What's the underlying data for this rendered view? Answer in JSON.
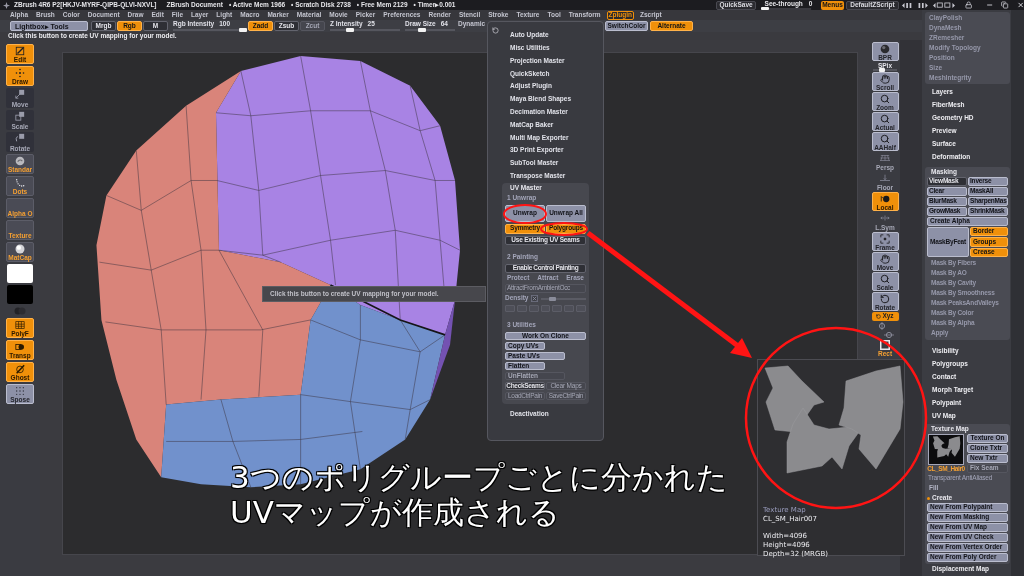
{
  "title_bar": {
    "app_title": "ZBrush 4R6 P2[HKJV-MYRF-QIPB-QLVI-NXVL]",
    "document": "ZBrush Document",
    "stats": [
      "• Active Mem 1966",
      "• Scratch Disk 2738",
      "• Free Mem 2129",
      "• Timer▸0.001"
    ],
    "quicksave": "QuickSave",
    "see_through": {
      "label": "See-through",
      "reading": "0",
      "level": 0
    },
    "menus": {
      "label": "Menus",
      "on": true
    },
    "script": "DefaultZScript"
  },
  "menu_bar": [
    {
      "label": "Alpha",
      "selected": false
    },
    {
      "label": "Brush",
      "selected": false
    },
    {
      "label": "Color",
      "selected": false
    },
    {
      "label": "Document",
      "selected": false
    },
    {
      "label": "Draw",
      "selected": false
    },
    {
      "label": "Edit",
      "selected": false
    },
    {
      "label": "File",
      "selected": false
    },
    {
      "label": "Layer",
      "selected": false
    },
    {
      "label": "Light",
      "selected": false
    },
    {
      "label": "Macro",
      "selected": false
    },
    {
      "label": "Marker",
      "selected": false
    },
    {
      "label": "Material",
      "selected": false
    },
    {
      "label": "Movie",
      "selected": false
    },
    {
      "label": "Picker",
      "selected": false
    },
    {
      "label": "Preferences",
      "selected": false
    },
    {
      "label": "Render",
      "selected": false
    },
    {
      "label": "Stencil",
      "selected": false
    },
    {
      "label": "Stroke",
      "selected": false
    },
    {
      "label": "Texture",
      "selected": false
    },
    {
      "label": "Tool",
      "selected": false
    },
    {
      "label": "Transform",
      "selected": false
    },
    {
      "label": "Zplugin",
      "selected": true
    },
    {
      "label": "Zscript",
      "selected": false
    }
  ],
  "shelf": [
    {
      "kind": "lightbox",
      "label": "Lightbox▸ Tools",
      "on": false,
      "disabled": false
    },
    {
      "kind": "button",
      "label": "Mrgb",
      "on": false,
      "disabled": false
    },
    {
      "kind": "button",
      "label": "Rgb",
      "on": true,
      "disabled": false
    },
    {
      "kind": "button",
      "label": "M",
      "on": false,
      "disabled": false
    },
    {
      "kind": "slider",
      "label": "Rgb Intensity",
      "reading": "100",
      "level": 1
    },
    {
      "kind": "button",
      "label": "Zadd",
      "on": true,
      "disabled": false
    },
    {
      "kind": "button",
      "label": "Zsub",
      "on": false,
      "disabled": false
    },
    {
      "kind": "button",
      "label": "Zcut",
      "on": false,
      "disabled": true
    },
    {
      "kind": "slider",
      "label": "Z Intensity",
      "reading": "25",
      "level": 0.25
    },
    {
      "kind": "slider",
      "label": "Draw Size",
      "reading": "64",
      "level": 0.3
    },
    {
      "kind": "text",
      "label": "Dynamic"
    }
  ],
  "shelf_right": [
    {
      "label": "SwitchColor",
      "on": false
    },
    {
      "label": "Alternate",
      "on": true
    }
  ],
  "help_line": "Click this button to create UV mapping for your model.",
  "left_toolbar": {
    "modes": [
      {
        "kind": "edit",
        "label": "Edit",
        "on": true
      },
      {
        "kind": "draw",
        "label": "Draw",
        "on": true
      },
      {
        "kind": "move",
        "label": "Move",
        "on": false
      },
      {
        "kind": "scale",
        "label": "Scale",
        "on": false
      },
      {
        "kind": "rotate",
        "label": "Rotate",
        "on": false
      }
    ],
    "previews": [
      {
        "kind": "brush",
        "label": "Standar"
      },
      {
        "kind": "stroke",
        "label": "Dots"
      },
      {
        "kind": "alpha",
        "label": "Alpha O"
      },
      {
        "kind": "texture",
        "label": "Texture"
      },
      {
        "kind": "material",
        "label": "MatCap"
      }
    ],
    "swatches": [
      {
        "color": "#ffffff"
      },
      {
        "color": "#000000"
      }
    ],
    "toggles": [
      {
        "kind": "polyframe",
        "label": "PolyF",
        "on": true
      },
      {
        "kind": "transparency",
        "label": "Transp",
        "on": true
      },
      {
        "kind": "ghost",
        "label": "Ghost",
        "on": true
      },
      {
        "kind": "spose",
        "label": "Spose",
        "on": false
      }
    ]
  },
  "right_shelf": {
    "bpr": {
      "label": "BPR"
    },
    "spix": {
      "label": "SPix",
      "level": 0.35
    },
    "buttons": [
      {
        "kind": "scroll",
        "label": "Scroll",
        "on": false
      },
      {
        "kind": "zoom",
        "label": "Zoom",
        "on": false
      },
      {
        "kind": "actual",
        "label": "Actual",
        "on": false
      },
      {
        "kind": "aahalf",
        "label": "AAHalf",
        "on": false
      },
      {
        "kind": "persp",
        "label": "Persp",
        "on": false
      },
      {
        "kind": "floor",
        "label": "Floor",
        "on": false
      },
      {
        "kind": "local",
        "label": "Local",
        "on": true
      },
      {
        "kind": "lsym",
        "label": "L.Sym",
        "on": false
      },
      {
        "kind": "frame",
        "label": "Frame",
        "on": false
      },
      {
        "kind": "move",
        "label": "Move",
        "on": false
      },
      {
        "kind": "scale",
        "label": "Scale",
        "on": false
      },
      {
        "kind": "rotate",
        "label": "Rotate",
        "on": false
      },
      {
        "kind": "xyz",
        "label": "Xyz",
        "on": true
      }
    ],
    "square": {
      "label": "Rect"
    }
  },
  "tooltip": "Click this button to create UV mapping for your model.",
  "zplugin_menu": {
    "items": [
      "Auto Update",
      "Misc Utilities",
      "Projection Master",
      "QuickSketch",
      "Adjust Plugin",
      "Maya Blend Shapes",
      "Decimation Master",
      "MatCap Baker",
      "Multi Map Exporter",
      "3D Print Exporter",
      "SubTool Master",
      "Transpose Master"
    ],
    "uv_master": {
      "title": "UV Master",
      "unwrap": {
        "heading": "1 Unwrap",
        "buttons": [
          {
            "label": "Unwrap",
            "disabled": false
          },
          {
            "label": "Unwrap All",
            "disabled": false
          }
        ],
        "switches": [
          {
            "label": "Symmetry",
            "on": true
          },
          {
            "label": "Polygroups",
            "on": true
          }
        ],
        "seams": {
          "label": "Use Existing UV Seams",
          "on": false
        }
      },
      "painting": {
        "heading": "2 Painting",
        "control": {
          "label": "Enable Control Painting",
          "on": false
        },
        "modes": [
          {
            "label": "Protect",
            "disabled": true
          },
          {
            "label": "Attract",
            "disabled": true
          },
          {
            "label": "Erase",
            "disabled": true
          }
        ],
        "ambient": {
          "label": "AttractFromAmbientOcc",
          "disabled": true
        },
        "density": {
          "label": "Density",
          "disabled": true
        }
      },
      "utilities": {
        "heading": "3 Utilities",
        "buttons": [
          {
            "label": "Work On Clone",
            "disabled": false
          },
          {
            "label": "Copy UVs",
            "disabled": false
          },
          {
            "label": "Paste UVs",
            "disabled": false
          },
          {
            "label": "Flatten",
            "disabled": false
          },
          {
            "label": "UnFlatten",
            "disabled": true
          }
        ],
        "check_seams": {
          "label": "CheckSeams",
          "on": false
        },
        "clear_maps": {
          "label": "Clear Maps",
          "disabled": true
        },
        "control_files": [
          {
            "label": "LoadCtrlPain",
            "disabled": true
          },
          {
            "label": "SaveCtrlPain",
            "disabled": true
          }
        ]
      }
    },
    "deactivation": "Deactivation"
  },
  "texture_preview": {
    "title": "Texture Map",
    "name": "CL_SM_Hair007",
    "info": [
      "Width=4096",
      "Height=4096",
      "Depth=32 (MRGB)"
    ]
  },
  "caption": [
    "3つのポリグループごとに分かれた",
    "UVマップが作成される"
  ],
  "tool_palette": {
    "top_group": [
      "ClayPolish",
      "DynaMesh",
      "ZRemesher",
      "Modify Topology",
      "Position",
      "Size",
      "MeshIntegrity"
    ],
    "sections_1": [
      "Layers",
      "FiberMesh",
      "Geometry HD",
      "Preview",
      "Surface",
      "Deformation"
    ],
    "masking": {
      "title": "Masking",
      "grid": [
        {
          "kind": "switch",
          "label": "ViewMask",
          "on": false
        },
        {
          "kind": "button",
          "label": "Inverse"
        },
        {
          "kind": "button",
          "label": "Clear"
        },
        {
          "kind": "button",
          "label": "MaskAll"
        },
        {
          "kind": "button",
          "label": "BlurMask"
        },
        {
          "kind": "button",
          "label": "SharpenMas"
        },
        {
          "kind": "button",
          "label": "GrowMask"
        },
        {
          "kind": "button",
          "label": "ShrinkMask"
        }
      ],
      "create_alpha": "Create Alpha",
      "mask_by_feature": "MaskByFeat",
      "feature_switches": [
        {
          "label": "Border",
          "on": true
        },
        {
          "label": "Groups",
          "on": true
        },
        {
          "label": "Crease",
          "on": true
        }
      ],
      "sub_items": [
        "Mask By Fibers",
        "Mask By AO",
        "Mask By Cavity",
        "Mask By Smoothness",
        "Mask PeaksAndValleys",
        "Mask By Color",
        "Mask By Alpha",
        "Apply"
      ]
    },
    "sections_2": [
      "Visibility",
      "Polygroups",
      "Contact",
      "Morph Target",
      "Polypaint",
      "UV Map"
    ],
    "texture_map": {
      "title": "Texture Map",
      "thumbnail_label": "CL_SM_Hair0",
      "texture_on": {
        "label": "Texture On",
        "on": false
      },
      "buttons": [
        {
          "label": "Clone Txtr",
          "disabled": false
        },
        {
          "label": "New Txtr",
          "disabled": false
        },
        {
          "label": "Fix Seam",
          "disabled": true
        }
      ],
      "transparent": "Transparent AntiAliased",
      "fill": "Fill",
      "create": "Create",
      "create_buttons": [
        "New From Polypaint",
        "New From Masking",
        "New From UV Map",
        "New From UV Check",
        "New From Vertex Order",
        "New From Poly Order"
      ]
    },
    "sections_3": [
      "Displacement Map"
    ]
  }
}
